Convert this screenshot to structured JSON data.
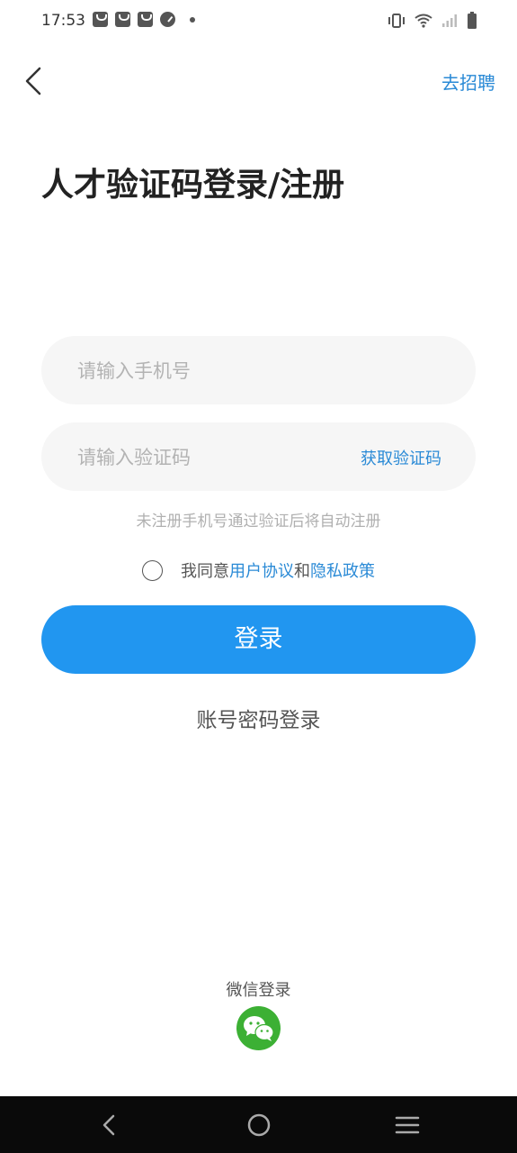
{
  "status_bar": {
    "time": "17:53",
    "icons": [
      "bag-icon",
      "bag-icon",
      "bag-icon",
      "speedometer-icon",
      "dot-icon",
      "vibrate-icon",
      "wifi-icon",
      "signal-icon",
      "battery-icon"
    ]
  },
  "header": {
    "back_icon": "chevron-left-icon",
    "recruit_link": "去招聘"
  },
  "title": "人才验证码登录/注册",
  "form": {
    "phone_placeholder": "请输入手机号",
    "code_placeholder": "请输入验证码",
    "get_code_label": "获取验证码",
    "hint": "未注册手机号通过验证后将自动注册",
    "agree_prefix": "我同意",
    "user_agreement": "用户协议",
    "agree_and": "和",
    "privacy_policy": "隐私政策",
    "login_button": "登录",
    "password_login": "账号密码登录"
  },
  "social": {
    "wechat_label": "微信登录",
    "wechat_icon": "wechat-icon"
  },
  "nav_bar": {
    "icons": [
      "nav-back-icon",
      "nav-home-icon",
      "nav-menu-icon"
    ]
  },
  "colors": {
    "accent": "#2196f0",
    "link": "#2a8ad6",
    "wechat": "#3cb034",
    "field_bg": "#f6f6f6",
    "nav_bg": "#0a0a0a"
  }
}
